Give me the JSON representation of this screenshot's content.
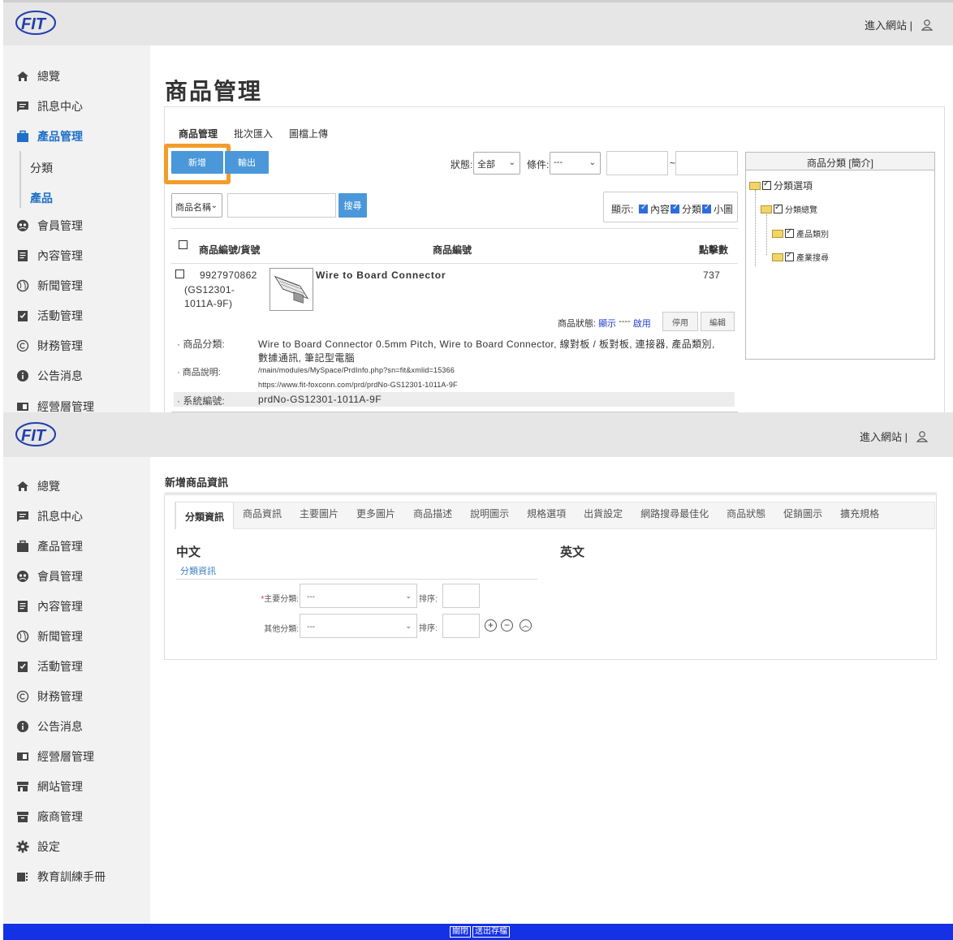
{
  "colors": {
    "accent": "#1e6fc8",
    "button_blue": "#4a98d9",
    "highlight": "#f39c2b",
    "footer": "#1431e6"
  },
  "header": {
    "logo": "FIT",
    "site_link": "進入網站 |",
    "user_icon": "user-icon"
  },
  "sidebar_top": [
    {
      "label": "總覽",
      "icon": "home-icon"
    },
    {
      "label": "訊息中心",
      "icon": "message-icon"
    },
    {
      "label": "產品管理",
      "icon": "briefcase-icon"
    },
    {
      "label": "分類",
      "icon": ""
    },
    {
      "label": "產品",
      "icon": ""
    },
    {
      "label": "會員管理",
      "icon": "member-icon"
    },
    {
      "label": "內容管理",
      "icon": "document-icon"
    },
    {
      "label": "新聞管理",
      "icon": "globe-icon"
    },
    {
      "label": "活動管理",
      "icon": "checklist-icon"
    },
    {
      "label": "財務管理",
      "icon": "copyright-icon"
    },
    {
      "label": "公告消息",
      "icon": "info-icon"
    },
    {
      "label": "經營層管理",
      "icon": "panel-icon"
    }
  ],
  "sidebar_bottom": [
    {
      "label": "總覽",
      "icon": "home-icon"
    },
    {
      "label": "訊息中心",
      "icon": "message-icon"
    },
    {
      "label": "產品管理",
      "icon": "briefcase-icon"
    },
    {
      "label": "會員管理",
      "icon": "member-icon"
    },
    {
      "label": "內容管理",
      "icon": "document-icon"
    },
    {
      "label": "新聞管理",
      "icon": "globe-icon"
    },
    {
      "label": "活動管理",
      "icon": "checklist-icon"
    },
    {
      "label": "財務管理",
      "icon": "copyright-icon"
    },
    {
      "label": "公告消息",
      "icon": "info-icon"
    },
    {
      "label": "經營層管理",
      "icon": "panel-icon"
    },
    {
      "label": "網站管理",
      "icon": "store-icon"
    },
    {
      "label": "廠商管理",
      "icon": "archive-icon"
    },
    {
      "label": "設定",
      "icon": "gear-icon"
    },
    {
      "label": "教育訓練手冊",
      "icon": "manual-icon"
    }
  ],
  "product_page": {
    "title": "商品管理",
    "tabs": [
      "商品管理",
      "批次匯入",
      "圖檔上傳"
    ],
    "add_button": "新增",
    "export_button": "輸出",
    "status_label": "狀態:",
    "status_value": "全部",
    "condition_label": "條件:",
    "condition_value": "---",
    "range_sep": "~",
    "search_field_select": "商品名稱",
    "search_button": "搜尋",
    "display_label": "顯示:",
    "display_options": [
      "內容",
      "分類",
      "小圖"
    ],
    "columns": [
      "商品編號/貨號",
      "商品編號",
      "點擊數"
    ],
    "product": {
      "number": "9927970862",
      "sku": "(GS12301-1011A-9F)",
      "name": "Wire to Board Connector",
      "clicks": "737",
      "status_label": "商品狀態:",
      "status_show": "顯示",
      "status_sep": "----",
      "status_enabled": "啟用",
      "disable_button": "停用",
      "edit_button": "編輯",
      "category_label": "· 商品分類:",
      "category_value": "Wire to Board Connector 0.5mm Pitch, Wire to Board Connector, 線對板 / 板對板, 連接器, 產品類別,",
      "category_value2": "數據通訊, 筆記型電腦",
      "desc_label": "· 商品說明:",
      "desc_value": "/main/modules/MySpace/PrdInfo.php?sn=fit&xmlid=15366",
      "desc_value2": "https://www.fit-foxconn.com/prd/prdNo-GS12301-1011A-9F",
      "sys_label": "· 系統編號:",
      "sys_value": "prdNo-GS12301-1011A-9F"
    },
    "category_tree": {
      "title": "商品分類 [簡介]",
      "root": "分類選項",
      "child": "分類總覽",
      "leaves": [
        "產品類別",
        "產業搜尋"
      ]
    }
  },
  "new_product": {
    "title": "新增商品資訊",
    "tabs": [
      "分類資訊",
      "商品資訊",
      "主要圖片",
      "更多圖片",
      "商品描述",
      "說明圖示",
      "規格選項",
      "出貨設定",
      "網路搜尋最佳化",
      "商品狀態",
      "促銷圖示",
      "擴充規格"
    ],
    "lang_zh": "中文",
    "lang_en": "英文",
    "section_link": "分類資訊",
    "required_mark": "*",
    "main_category_label": "主要分類:",
    "main_category_value": "---",
    "other_category_label": "其他分類:",
    "other_category_value": "---",
    "sort_label": "排序:",
    "add_icon": "plus-circle-icon",
    "remove_icon": "minus-circle-icon",
    "up_icon": "chevron-up-circle-icon"
  },
  "footer": {
    "close_button": "關閉",
    "submit_button": "送出存檔"
  }
}
